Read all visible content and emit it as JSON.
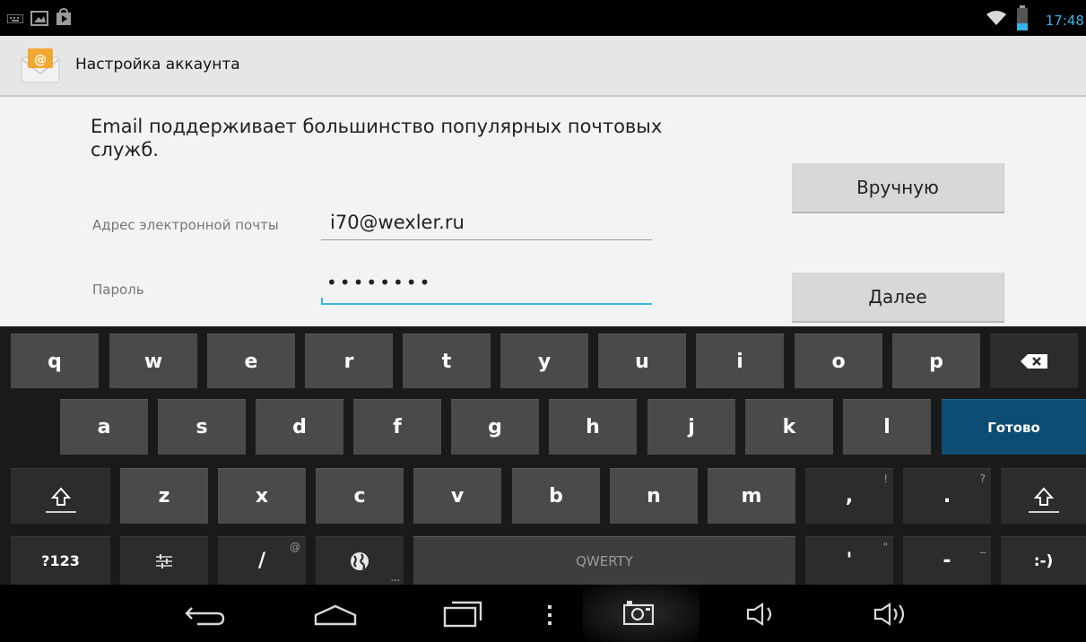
{
  "statusbar": {
    "time": "17:48",
    "left_icons": [
      "keyboard-icon",
      "image-icon",
      "store-icon"
    ],
    "right_icons": [
      "wifi-icon",
      "battery-icon"
    ],
    "accent": "#33b5e5"
  },
  "actionbar": {
    "title": "Настройка аккаунта",
    "app_icon": "email-envelope-icon"
  },
  "form": {
    "intro": "Email поддерживает большинство популярных почтовых служб.",
    "email_label": "Адрес электронной почты",
    "email_value": "i70@wexler.ru",
    "password_label": "Пароль",
    "password_value": "••••••••",
    "manual_button": "Вручную",
    "next_button": "Далее"
  },
  "keyboard": {
    "row1": [
      "q",
      "w",
      "e",
      "r",
      "t",
      "y",
      "u",
      "i",
      "o",
      "p"
    ],
    "backspace_icon": "backspace-icon",
    "row2": [
      "a",
      "s",
      "d",
      "f",
      "g",
      "h",
      "j",
      "k",
      "l"
    ],
    "action_label": "Готово",
    "action_color": "#0d4d74",
    "row3": [
      "z",
      "x",
      "c",
      "v",
      "b",
      "n",
      "m"
    ],
    "comma": ",",
    "comma_hint": "!",
    "period": ".",
    "period_hint": "?",
    "symbols_label": "?123",
    "settings_icon": "settings-sliders-icon",
    "slash": "/",
    "slash_hint": "@",
    "language_icon": "globe-icon",
    "space_label": "QWERTY",
    "apostrophe": "'",
    "apostrophe_hint": "\"",
    "dash": "-",
    "dash_hint": "_",
    "smiley": ":-)"
  },
  "navbar": {
    "icons": [
      "back-icon",
      "home-icon",
      "recent-apps-icon",
      "menu-icon",
      "camera-icon",
      "volume-down-icon",
      "volume-up-icon"
    ]
  }
}
